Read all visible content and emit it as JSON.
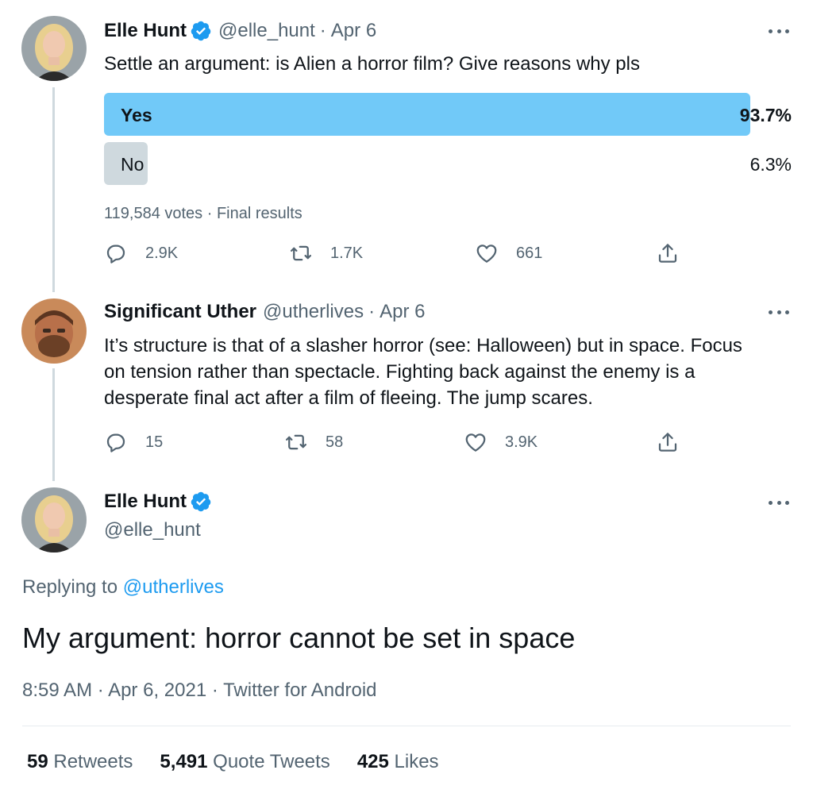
{
  "tweet1": {
    "name": "Elle Hunt",
    "handle": "@elle_hunt",
    "separator": "·",
    "date": "Apr 6",
    "text": "Settle an argument: is Alien a horror film? Give reasons why pls",
    "poll": {
      "options": [
        {
          "label": "Yes",
          "percent_text": "93.7%",
          "percent": 93.7,
          "winner": true
        },
        {
          "label": "No",
          "percent_text": "6.3%",
          "percent": 6.3,
          "winner": false
        }
      ],
      "votes": "119,584 votes",
      "status": "Final results",
      "colors": {
        "winner": "#71c9f8",
        "other": "#cfd9de"
      }
    },
    "actions": {
      "replies": "2.9K",
      "retweets": "1.7K",
      "likes": "661"
    }
  },
  "tweet2": {
    "name": "Significant Uther",
    "handle": "@utherlives",
    "separator": "·",
    "date": "Apr 6",
    "text_lines": [
      "It’s structure is that of a slasher horror (see: Halloween) but in space. Focus",
      "on tension rather than spectacle. Fighting back against the enemy is a",
      "desperate final act after a film of fleeing. The jump scares."
    ],
    "actions": {
      "replies": "15",
      "retweets": "58",
      "likes": "3.9K"
    }
  },
  "main_tweet": {
    "name": "Elle Hunt",
    "handle": "@elle_hunt",
    "replying_prefix": "Replying to ",
    "replying_handle": "@utherlives",
    "text": "My argument: horror cannot be set in space",
    "time": "8:59 AM",
    "full_date": "Apr 6, 2021",
    "source": "Twitter for Android",
    "separator": "·",
    "stats": {
      "retweets_count": "59",
      "retweets_label": "Retweets",
      "quotes_count": "5,491",
      "quotes_label": "Quote Tweets",
      "likes_count": "425",
      "likes_label": "Likes"
    }
  },
  "colors": {
    "verified": "#1d9bf0",
    "link": "#1d9bf0",
    "secondary": "#536471",
    "thread_line": "#cfd9de"
  },
  "icons": [
    "reply-icon",
    "retweet-icon",
    "like-icon",
    "share-icon",
    "verified-icon",
    "more-icon"
  ]
}
